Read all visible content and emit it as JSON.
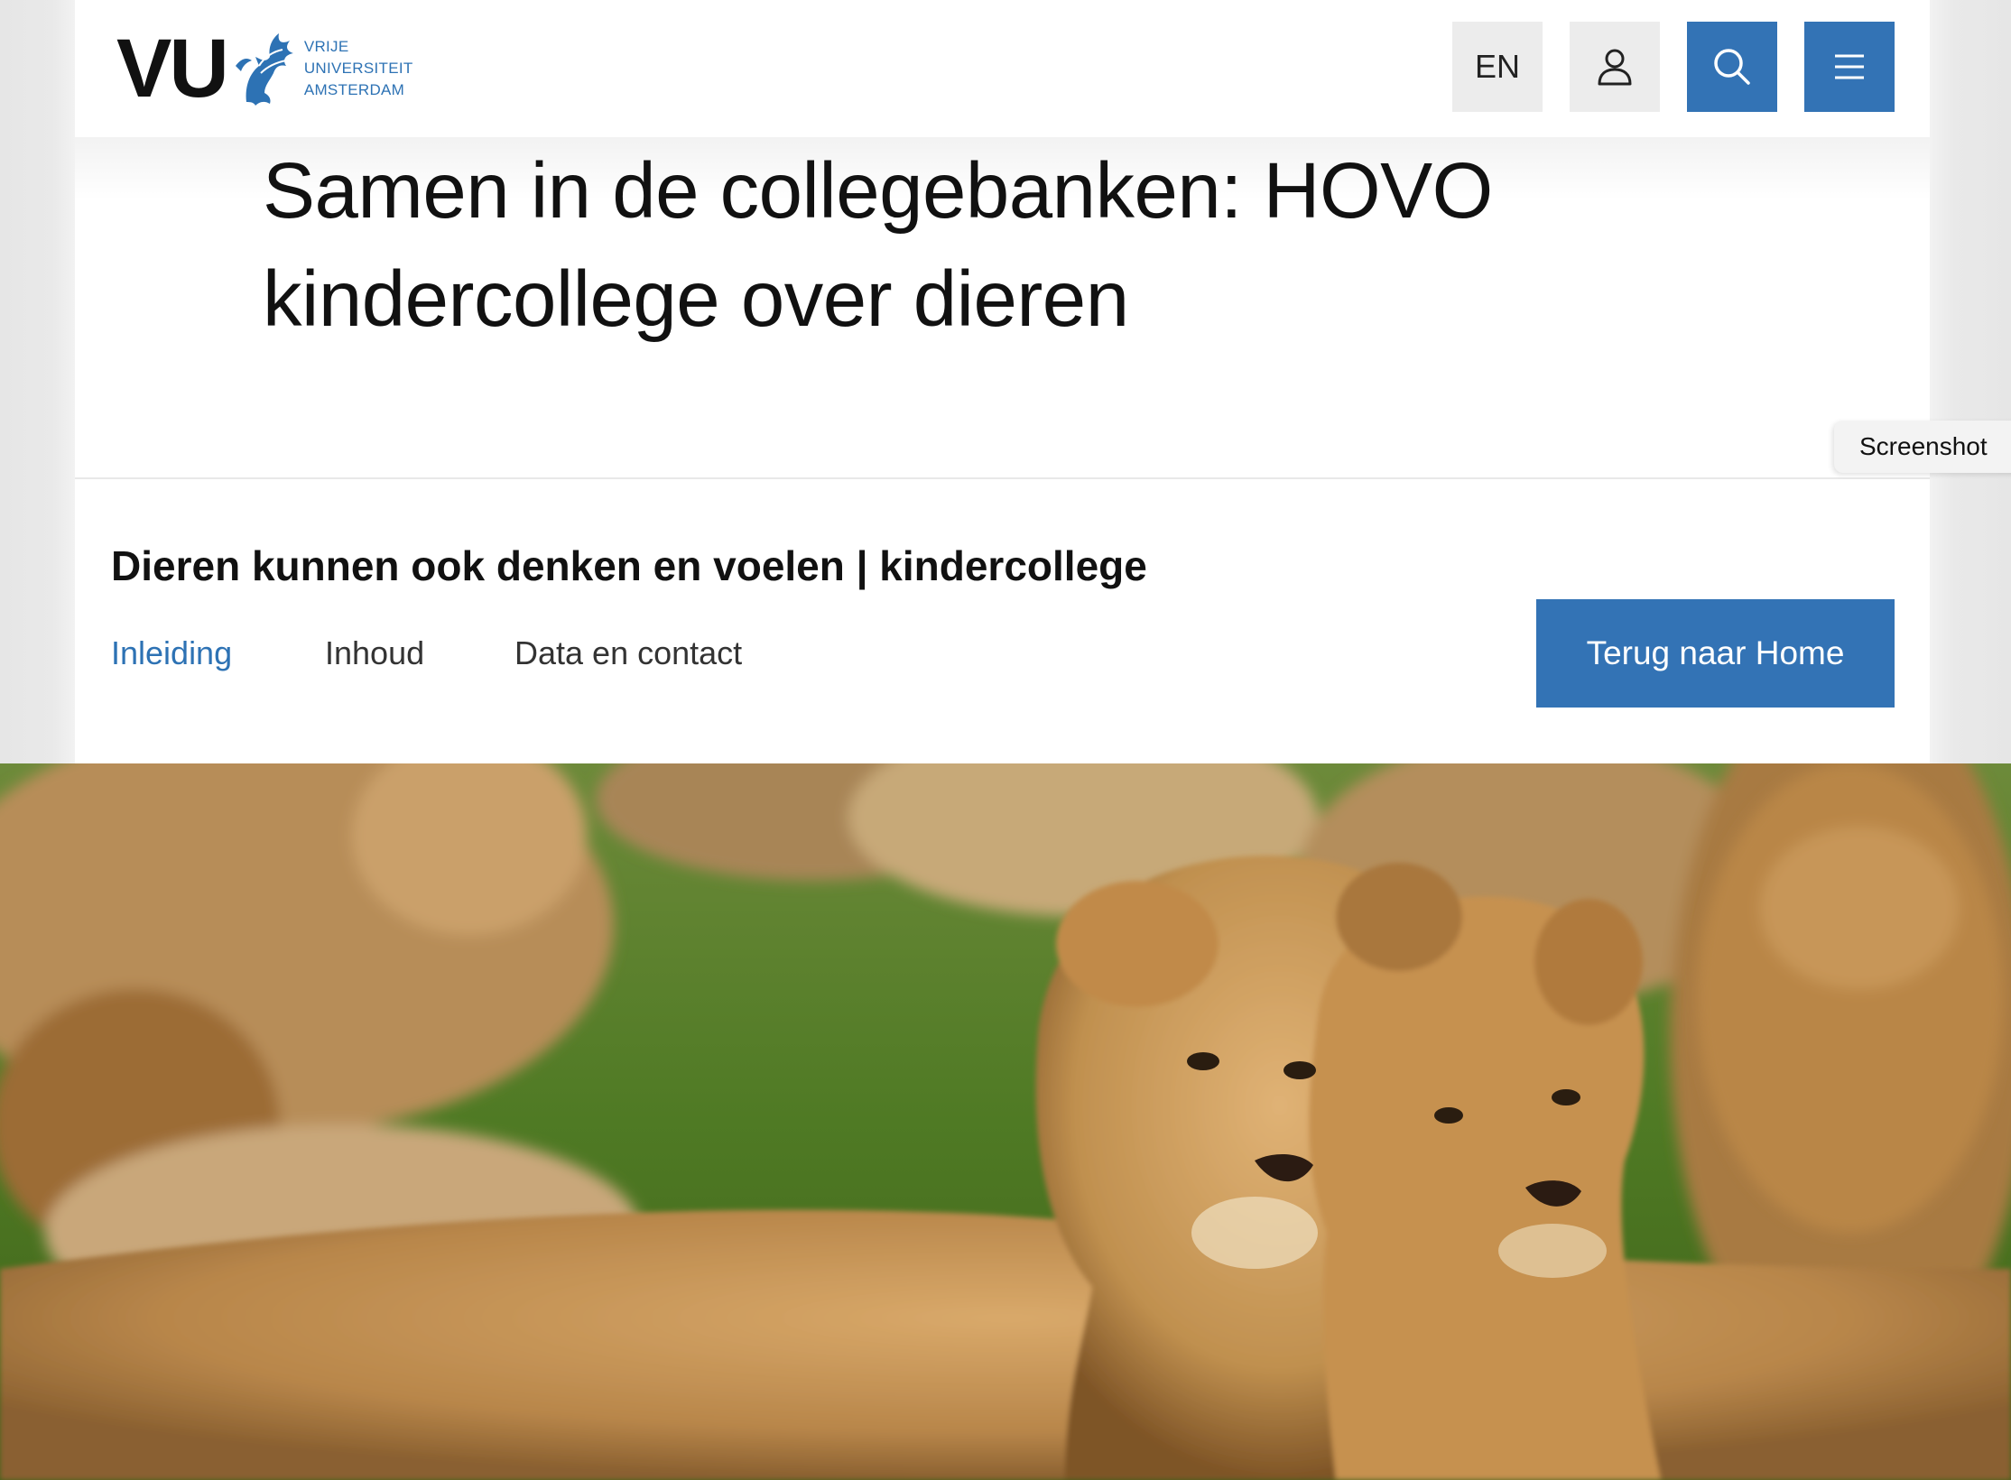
{
  "header": {
    "logo": {
      "mark": "VU",
      "lines": [
        "VRIJE",
        "UNIVERSITEIT",
        "AMSTERDAM"
      ]
    },
    "language_label": "EN",
    "icons": {
      "user": "user-icon",
      "search": "search-icon",
      "menu": "menu-icon"
    },
    "colors": {
      "accent": "#3373b5",
      "neutral_button": "#ececec"
    }
  },
  "page": {
    "title": "Samen in de collegebanken: HOVO kindercollege over dieren",
    "subtitle": "Dieren kunnen ook denken en voelen | kindercollege"
  },
  "subnav": {
    "items": [
      {
        "label": "Inleiding",
        "active": true
      },
      {
        "label": "Inhoud",
        "active": false
      },
      {
        "label": "Data en contact",
        "active": false
      }
    ],
    "cta_label": "Terug naar Home"
  },
  "overlay": {
    "screenshot_label": "Screenshot"
  }
}
